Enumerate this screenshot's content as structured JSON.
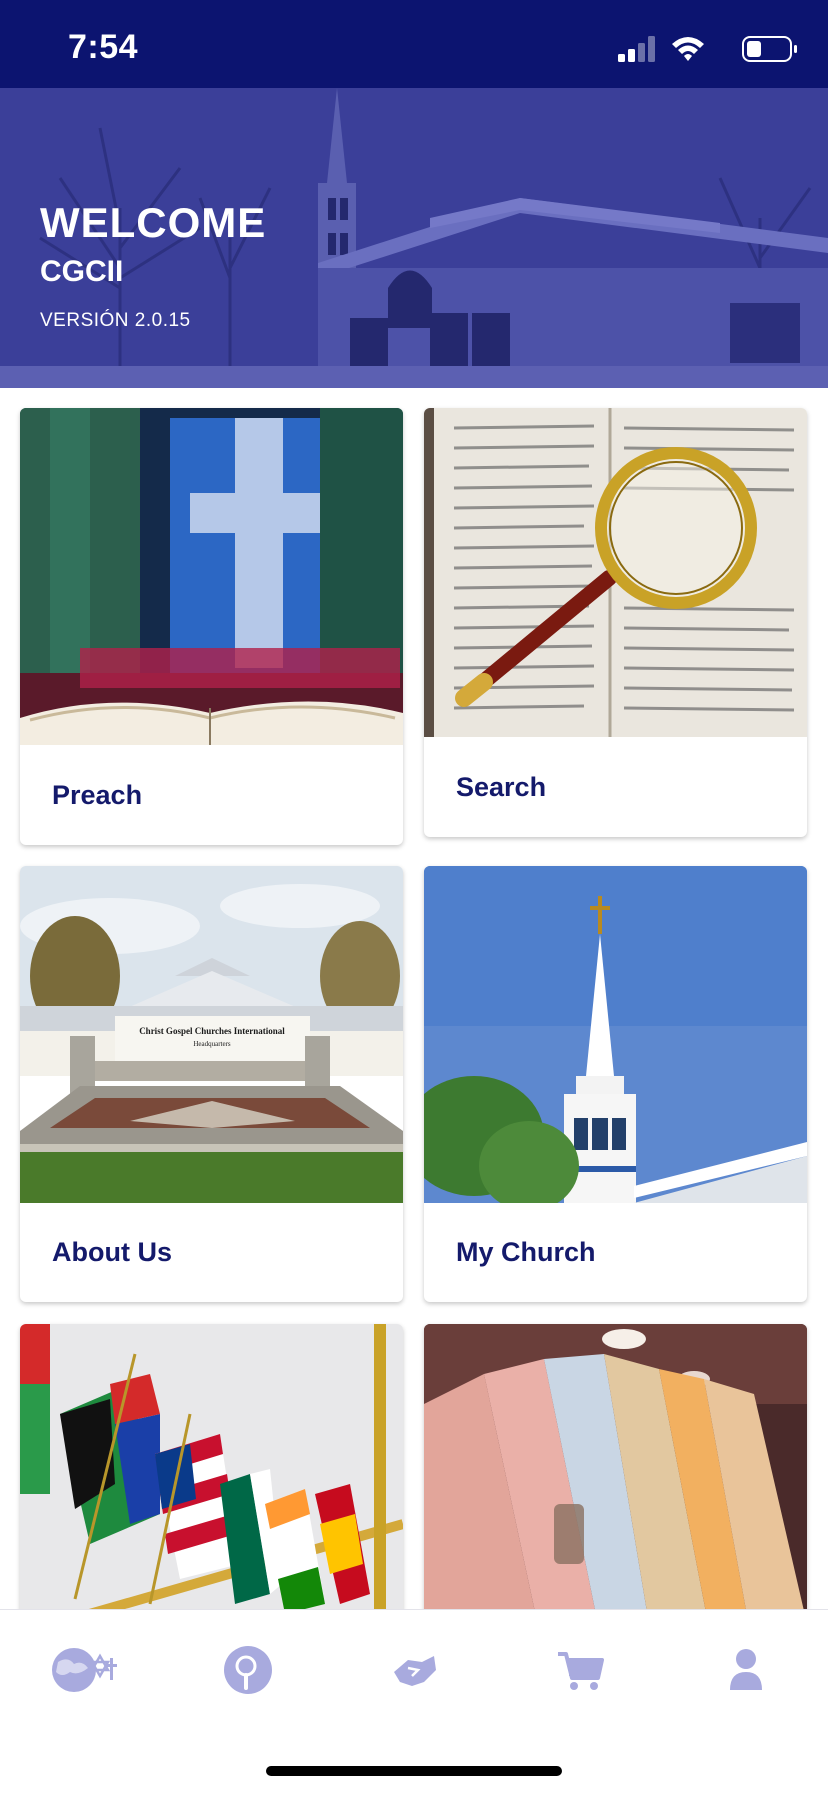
{
  "status_bar": {
    "time": "7:54"
  },
  "header": {
    "welcome": "WELCOME",
    "org": "CGCII",
    "version": "VERSIÓN 2.0.15"
  },
  "cards": [
    {
      "label": "Preach"
    },
    {
      "label": "Search"
    },
    {
      "label": "About Us"
    },
    {
      "label": "My Church"
    },
    {
      "label": ""
    },
    {
      "label": ""
    }
  ],
  "about_image_sign": {
    "line1": "Christ Gospel Churches International",
    "line2": "Headquarters"
  },
  "tab_bar": {
    "items": [
      {
        "icon": "globe-star-cross-icon"
      },
      {
        "icon": "search-icon"
      },
      {
        "icon": "handshake-icon"
      },
      {
        "icon": "cart-icon"
      },
      {
        "icon": "user-icon"
      }
    ],
    "icon_color": "#9ea0d8"
  },
  "colors": {
    "brand": "#0c1470",
    "label": "#141a6b"
  }
}
